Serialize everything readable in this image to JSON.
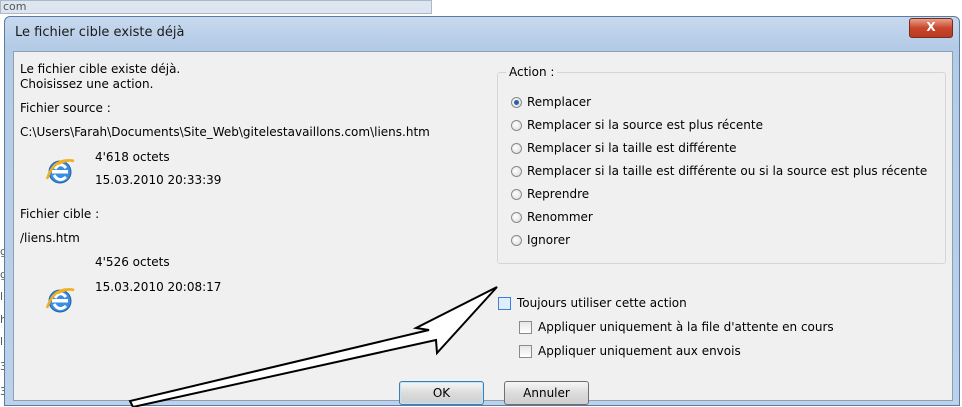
{
  "background": {
    "top_text": "com",
    "side_chars": [
      "g",
      "g",
      "l",
      "h",
      "l",
      "3",
      "3"
    ]
  },
  "dialog": {
    "title": "Le fichier cible existe déjà",
    "close_label": "X",
    "message_line1": "Le fichier cible existe déjà.",
    "message_line2": "Choisissez une action.",
    "source": {
      "label": "Fichier source :",
      "path": "C:\\Users\\Farah\\Documents\\Site_Web\\gitelestavaillons.com\\liens.htm",
      "size": "4'618 octets",
      "date": "15.03.2010 20:33:39"
    },
    "target": {
      "label": "Fichier cible :",
      "path": "/liens.htm",
      "size": "4'526 octets",
      "date": "15.03.2010 20:08:17"
    },
    "action_group": {
      "label": "Action :",
      "options": [
        {
          "label": "Remplacer",
          "checked": true
        },
        {
          "label": "Remplacer si la source est plus récente",
          "checked": false
        },
        {
          "label": "Remplacer si la taille est différente",
          "checked": false
        },
        {
          "label": "Remplacer si la taille est différente ou si la source est plus récente",
          "checked": false
        },
        {
          "label": "Reprendre",
          "checked": false
        },
        {
          "label": "Renommer",
          "checked": false
        },
        {
          "label": "Ignorer",
          "checked": false
        }
      ]
    },
    "always_use": "Toujours utiliser cette action",
    "apply_queue": "Appliquer uniquement à la file d'attente en cours",
    "apply_uploads": "Appliquer uniquement aux envois",
    "ok_label": "OK",
    "cancel_label": "Annuler"
  },
  "colors": {
    "accent": "#2a60b0",
    "title_bar": "#bcd1ea",
    "close_button": "#c9462c"
  }
}
